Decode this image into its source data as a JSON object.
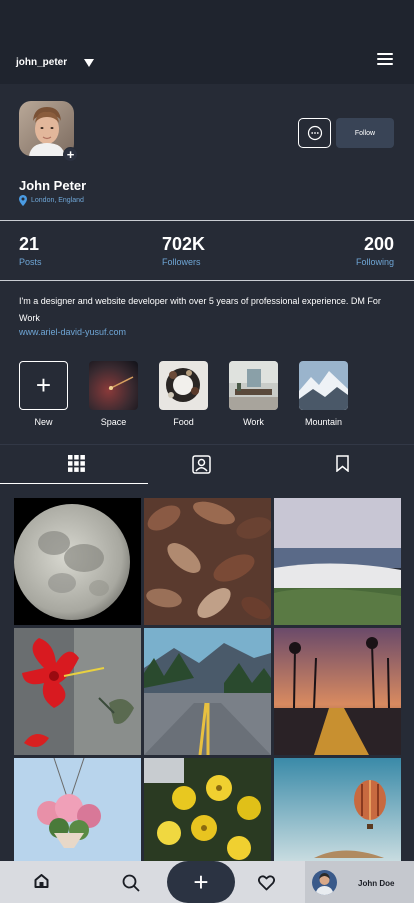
{
  "header": {
    "username": "john_peter"
  },
  "profile": {
    "name": "John Peter",
    "location": "London, England",
    "follow_label": "Follow"
  },
  "stats": [
    {
      "value": "21",
      "label": "Posts"
    },
    {
      "value": "702K",
      "label": "Followers"
    },
    {
      "value": "200",
      "label": "Following"
    }
  ],
  "bio": {
    "text": "I'm a designer and website developer with over 5 years of professional experience. DM For Work",
    "website": "www.ariel-david-yusuf.com"
  },
  "highlights": [
    {
      "label": "New",
      "icon": "plus-icon"
    },
    {
      "label": "Space"
    },
    {
      "label": "Food"
    },
    {
      "label": "Work"
    },
    {
      "label": "Mountain"
    }
  ],
  "tabs": [
    {
      "icon": "grid-icon",
      "active": true
    },
    {
      "icon": "tagged-icon",
      "active": false
    },
    {
      "icon": "bookmark-icon",
      "active": false
    }
  ],
  "grid_posts": [
    "moon",
    "dry-leaves",
    "beach-shore",
    "hibiscus-hummingbird",
    "mountain-road",
    "sunset-road",
    "hanging-flowers",
    "yellow-flowers",
    "hot-air-balloon"
  ],
  "bottom_nav": {
    "items": [
      "home-icon",
      "search-icon",
      "add-icon",
      "heart-icon"
    ],
    "profile_name": "John Doe"
  },
  "colors": {
    "background": "#262b36",
    "topbar": "#1f242e",
    "accent": "#6fa6d6",
    "follow_button": "#394456",
    "bottom_nav": "#d9dbe0"
  }
}
